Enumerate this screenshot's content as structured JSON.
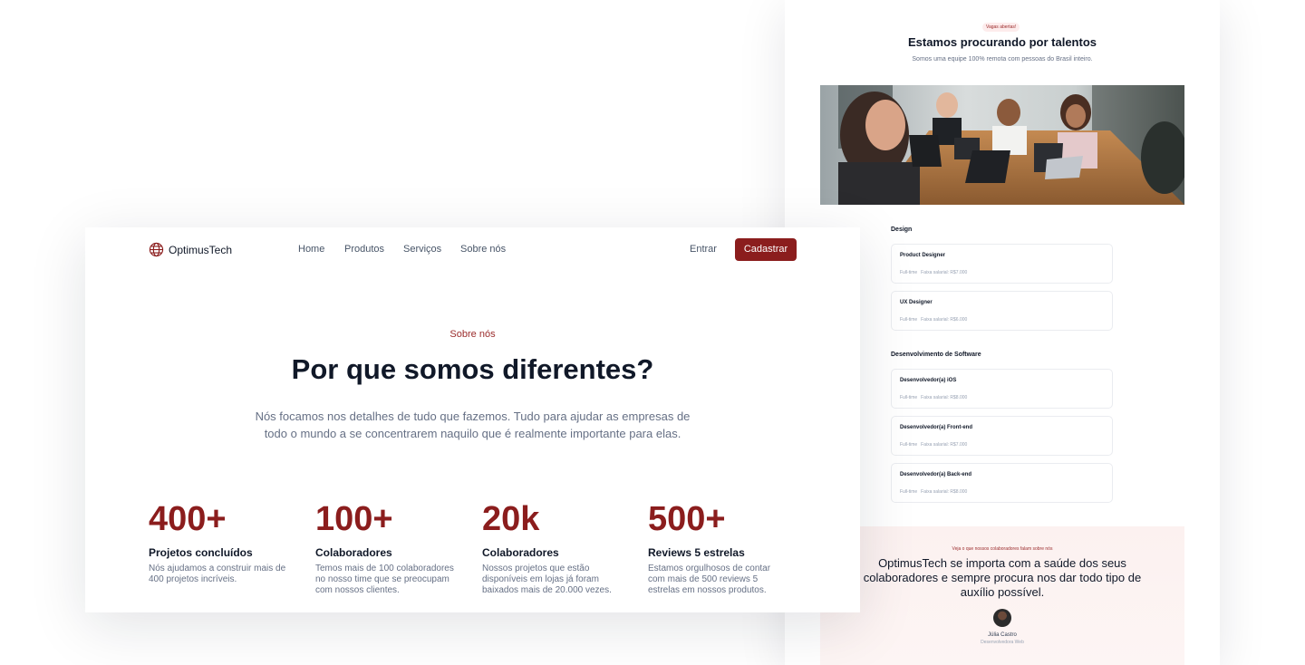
{
  "careers": {
    "badge": "Vagas abertas!",
    "title": "Estamos procurando por talentos",
    "subtitle": "Somos uma equipe 100% remota com pessoas do Brasil inteiro.",
    "sections": [
      {
        "name": "Design",
        "jobs": [
          {
            "title": "Product Designer",
            "type": "Full-time",
            "salary": "Faixa salarial: R$7.000"
          },
          {
            "title": "UX Designer",
            "type": "Full-time",
            "salary": "Faixa salarial: R$6.000"
          }
        ]
      },
      {
        "name": "Desenvolvimento de Software",
        "jobs": [
          {
            "title": "Desenvolvedor(a) iOS",
            "type": "Full-time",
            "salary": "Faixa salarial: R$8.000"
          },
          {
            "title": "Desenvolvedor(a) Front-end",
            "type": "Full-time",
            "salary": "Faixa salarial: R$7.000"
          },
          {
            "title": "Desenvolvedor(a) Back-end",
            "type": "Full-time",
            "salary": "Faixa salarial: R$8.000"
          }
        ]
      }
    ],
    "testimonial": {
      "kicker": "Veja o que nossos colaboradores falam sobre nós",
      "quote_lines": [
        "OptimusTech se importa com a saúde dos seus",
        "colaboradores e sempre procura nos dar todo tipo de",
        "auxílio possível."
      ],
      "name": "Júlia Castro",
      "role": "Desenvolvedora Web"
    }
  },
  "about": {
    "brand": "OptimusTech",
    "nav": [
      "Home",
      "Produtos",
      "Serviços",
      "Sobre nós"
    ],
    "login": "Entrar",
    "signup": "Cadastrar",
    "kicker": "Sobre nós",
    "heading": "Por que somos diferentes?",
    "description_lines": [
      "Nós focamos nos detalhes de tudo que fazemos. Tudo para ajudar as empresas de",
      "todo o mundo a se concentrarem naquilo que é realmente importante para elas."
    ],
    "stats": [
      {
        "value": "400+",
        "label": "Projetos concluídos",
        "desc_lines": [
          "Nós ajudamos a construir mais de",
          "400 projetos incríveis."
        ]
      },
      {
        "value": "100+",
        "label": "Colaboradores",
        "desc_lines": [
          "Temos mais de 100 colaboradores",
          "no nosso time que se preocupam",
          "com nossos clientes."
        ]
      },
      {
        "value": "20k",
        "label": "Colaboradores",
        "desc_lines": [
          "Nossos projetos que estão",
          "disponíveis em lojas já foram",
          "baixados mais de 20.000 vezes."
        ]
      },
      {
        "value": "500+",
        "label": "Reviews 5 estrelas",
        "desc_lines": [
          "Estamos orgulhosos de contar",
          "com mais de 500 reviews 5",
          "estrelas em nossos produtos."
        ]
      }
    ]
  },
  "colors": {
    "brand": "#8b1d1d",
    "accent_text": "#9b2c2c",
    "heading": "#101828",
    "muted": "#667085"
  }
}
